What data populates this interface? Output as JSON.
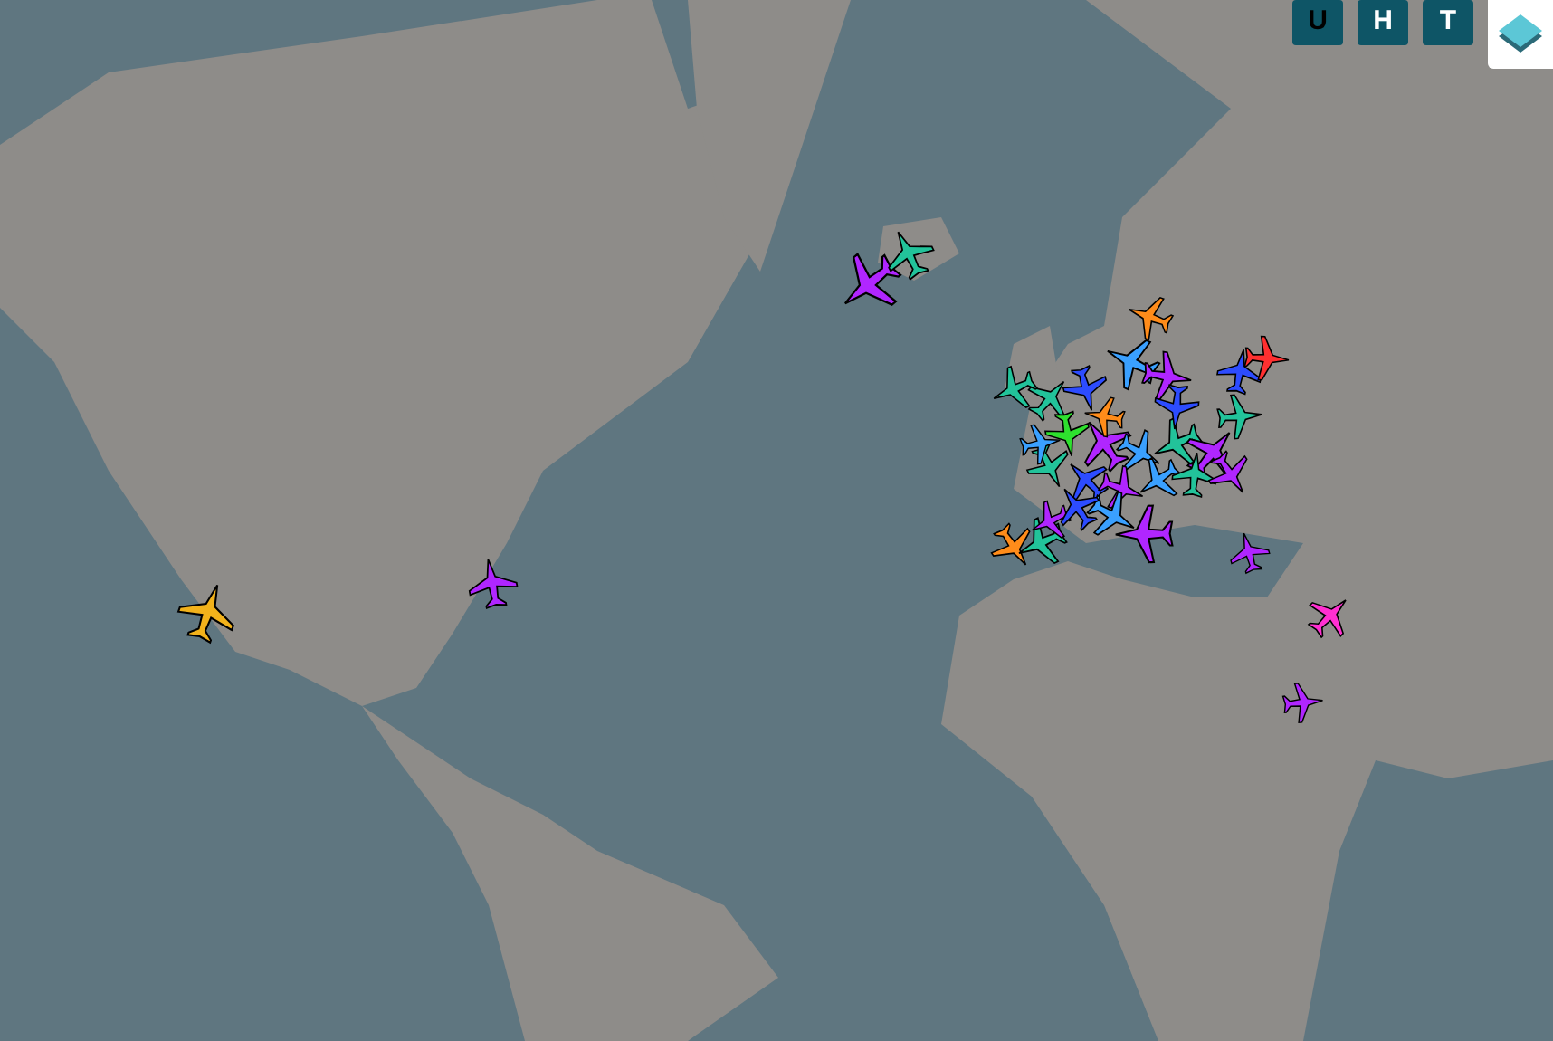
{
  "toggles": [
    {
      "label": "U",
      "selected": false
    },
    {
      "label": "H",
      "selected": true
    },
    {
      "label": "T",
      "selected": true
    }
  ],
  "layers_button": {
    "kind": "layers"
  }
}
